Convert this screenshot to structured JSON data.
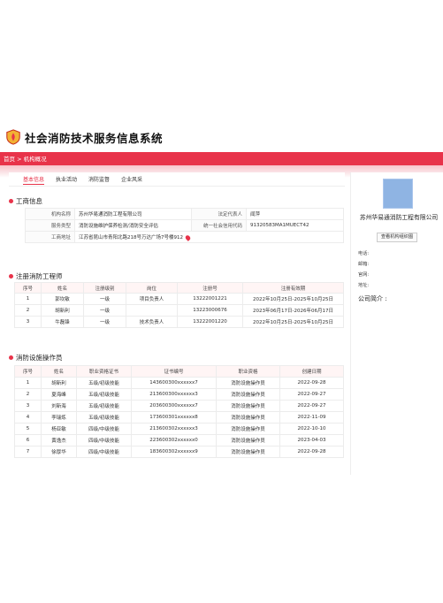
{
  "app": {
    "title": "社会消防技术服务信息系统"
  },
  "breadcrumb": {
    "home": "首页",
    "sep": ">",
    "current": "机构概况"
  },
  "tabs": [
    "基本信息",
    "执业活动",
    "消防监督",
    "企业风采"
  ],
  "basic": {
    "title": "工商信息",
    "rows": [
      {
        "k1": "机构名称",
        "v1": "苏州华易通消防工程有限公司",
        "k2": "法定代表人",
        "v2": "闻萍"
      },
      {
        "k1": "服务类型",
        "v1": "消防设施维护保养检测/消防安全评估",
        "k2": "统一社会信用代码",
        "v2": "91320583MA1MUECT42"
      },
      {
        "k1": "工商地址",
        "v1": "江苏省昆山市青阳北路218号万达广场7号楼912"
      }
    ]
  },
  "engineers": {
    "title": "注册消防工程师",
    "headers": [
      "序号",
      "姓名",
      "注册级别",
      "岗位",
      "注册号",
      "注册有效期"
    ],
    "rows": [
      [
        "1",
        "郭坎敏",
        "一级",
        "项目负责人",
        "13222001221",
        "2022年10月25日-2025年10月25日"
      ],
      [
        "2",
        "胡新利",
        "一级",
        "",
        "13223000676",
        "2023年06月17日-2026年06月17日"
      ],
      [
        "3",
        "牛磊锋",
        "一级",
        "技术负责人",
        "13222001220",
        "2022年10月25日-2025年10月25日"
      ]
    ]
  },
  "operators": {
    "title": "消防设施操作员",
    "headers": [
      "序号",
      "姓名",
      "职业资格证书",
      "证书编号",
      "职业资格",
      "创建日期"
    ],
    "rows": [
      [
        "1",
        "胡新利",
        "五级/初级技能",
        "143600300xxxxxx7",
        "消防设施操作员",
        "2022-09-28"
      ],
      [
        "2",
        "夏海峰",
        "五级/初级技能",
        "213600300xxxxxx3",
        "消防设施操作员",
        "2022-09-27"
      ],
      [
        "3",
        "刘新海",
        "五级/初级技能",
        "203600300xxxxxx7",
        "消防设施操作员",
        "2022-09-27"
      ],
      [
        "4",
        "李瑞炼",
        "五级/初级技能",
        "173600301xxxxxx8",
        "消防设施操作员",
        "2022-11-09"
      ],
      [
        "5",
        "杨亚敏",
        "四级/中级技能",
        "213600302xxxxxx3",
        "消防设施操作员",
        "2022-10-10"
      ],
      [
        "6",
        "黄逸杰",
        "四级/中级技能",
        "223600302xxxxxx0",
        "消防设施操作员",
        "2023-04-03"
      ],
      [
        "7",
        "徐厚华",
        "四级/中级技能",
        "183600302xxxxxx9",
        "消防设施操作员",
        "2022-09-28"
      ]
    ]
  },
  "sidebar": {
    "company": "苏州华易通消防工程有限公司",
    "button": "查看机构组织图",
    "fields": [
      "电话:",
      "邮箱:",
      "官网:",
      "地址:"
    ],
    "intro": "公司简介 :"
  },
  "colors": {
    "accent": "#e8334a",
    "header_band": "#f8c4cb",
    "logo_box": "#8fb4e3"
  },
  "icons": {
    "brand": "shield-logo-icon",
    "location": "map-pin-icon"
  }
}
